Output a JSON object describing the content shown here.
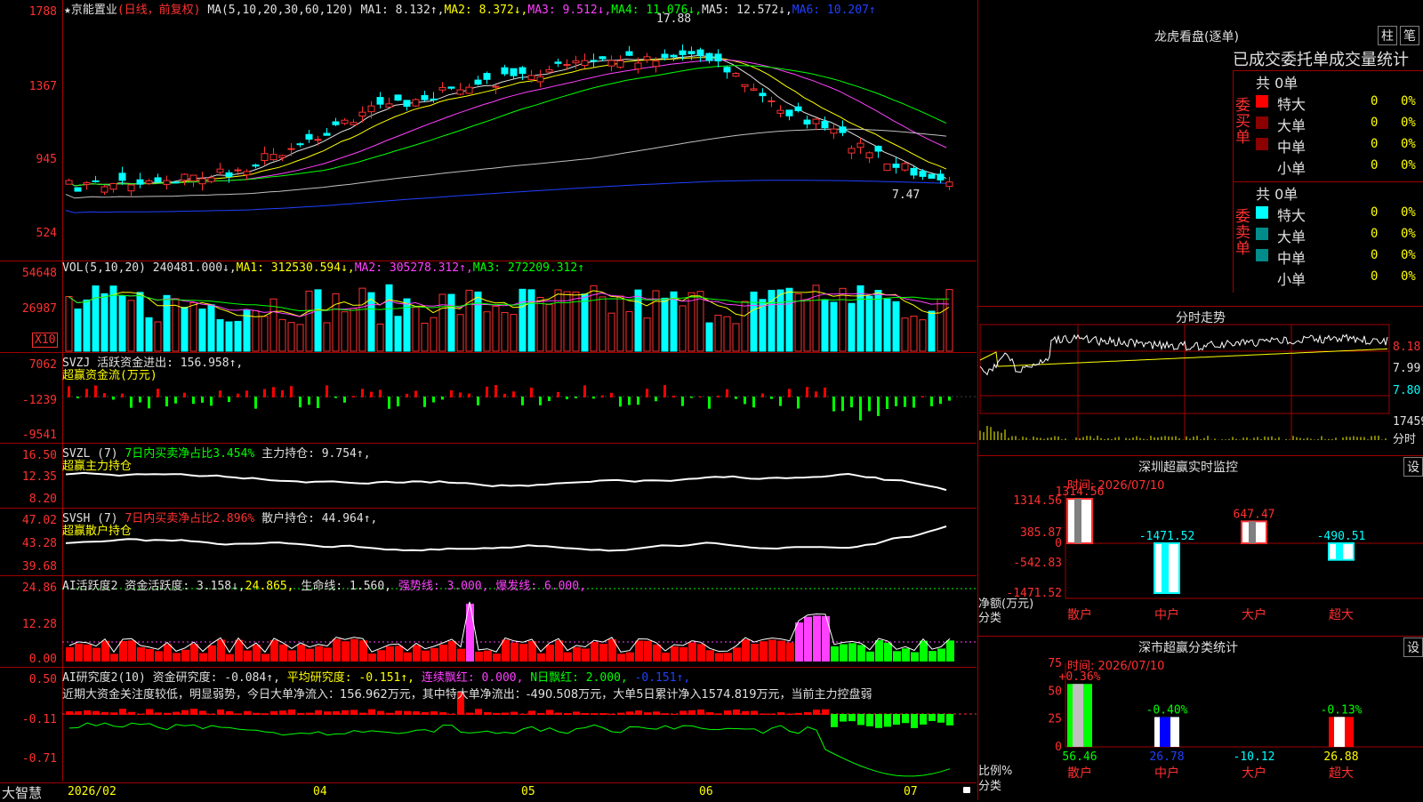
{
  "stock": {
    "star": "★",
    "name": "京能置业",
    "mode": "(日线，前复权)",
    "ma_def": "MA(5,10,20,30,60,120)",
    "ma1": "MA1: 8.132↑,",
    "ma2": "MA2: 8.372↓,",
    "ma3": "MA3: 9.512↓,",
    "ma4": "MA4: 11.076↓,",
    "ma5": "MA5: 12.572↓,",
    "ma6": "MA6: 10.207↑",
    "high_label": "17.88",
    "low_label": "7.47",
    "price_axis": [
      "1788",
      "1367",
      "945",
      "524"
    ]
  },
  "vol": {
    "def": "VOL(5,10,20)",
    "value": "240481.000↓,",
    "ma1": "MA1: 312530.594↓,",
    "ma2": "MA2: 305278.312↑,",
    "ma3": "MA3: 272209.312↑",
    "axis": [
      "54648",
      "26987",
      "X10"
    ]
  },
  "svzj": {
    "def": "SVZJ  活跃资金进出: 156.958↑,",
    "subtitle": "超赢资金流(万元)",
    "axis": [
      "7062",
      "-1239",
      "-9541"
    ]
  },
  "svzl": {
    "def": "SVZL (7)",
    "ratio": "7日内买卖净占比3.454%",
    "hold": "主力持仓: 9.754↑,",
    "subtitle": "超赢主力持仓",
    "axis": [
      "16.50",
      "12.35",
      "8.20"
    ]
  },
  "svsh": {
    "def": "SVSH (7)",
    "ratio": "7日内买卖净占比2.896%",
    "hold": "散户持仓: 44.964↑,",
    "subtitle": "超赢散户持仓",
    "axis": [
      "47.02",
      "43.28",
      "39.68"
    ]
  },
  "ai_active": {
    "def": "AI活跃度2",
    "v1": "资金活跃度: 3.158↓,",
    "v2": "24.865,",
    "v3": "生命线: 1.560,",
    "v4": "强势线: 3.000,",
    "v5": "爆发线: 6.000,",
    "axis": [
      "24.86",
      "12.28",
      "0.00"
    ]
  },
  "ai_research": {
    "def": "AI研究度2(10)",
    "v1": "资金研究度: -0.084↑,",
    "v2": "平均研究度: -0.151↑,",
    "v3": "连续飘红: 0.000,",
    "v4": "N日飘红: 2.000,",
    "v5": "-0.151↑,",
    "comment": "近期大资金关注度较低，明显弱势，今日大单净流入：156.962万元，其中特大单净流出：-490.508万元，大单5日累计净入1574.819万元，当前主力控盘弱",
    "axis": [
      "0.50",
      "-0.11",
      "-0.71"
    ]
  },
  "bottom": {
    "app": "大智慧",
    "months": [
      "2026/02",
      "04",
      "05",
      "06",
      "07"
    ]
  },
  "dragon": {
    "title": "龙虎看盘(逐单)",
    "btn1": "柱",
    "btn2": "笔",
    "subtitle": "已成交委托单成交量统计",
    "buy_label": "委买单",
    "sell_label": "委卖单",
    "buy_total": "共 0单",
    "sell_total": "共 0单",
    "rows": [
      "特大",
      "大单",
      "中单",
      "小单"
    ],
    "zero": "0",
    "pct": "0%",
    "colors_buy": [
      "#ff0000",
      "#8b0000",
      "#8b0000",
      "#000000"
    ],
    "colors_sell": [
      "#00ffff",
      "#008b8b",
      "#008b8b",
      "#000000"
    ]
  },
  "intraday": {
    "title": "分时走势",
    "prices": [
      "8.18",
      "7.99",
      "7.80"
    ],
    "vol": "17459",
    "time_label": "分时"
  },
  "sz_monitor": {
    "title": "深圳超赢实时监控",
    "btn": "设",
    "time": "时间: 2026/07/10",
    "axis": [
      "1314.56",
      "385.87",
      "0",
      "-542.83",
      "-1471.52"
    ],
    "left_label1": "净额(万元)",
    "left_label2": "分类",
    "bars": [
      {
        "label": "散户",
        "value": "1314.56"
      },
      {
        "label": "中户",
        "value": "-1471.52"
      },
      {
        "label": "大户",
        "value": "647.47"
      },
      {
        "label": "超大",
        "value": "-490.51"
      }
    ]
  },
  "sz_class": {
    "title": "深市超赢分类统计",
    "btn": "设",
    "time": "时间: 2026/07/10",
    "axis": [
      "75",
      "50",
      "25",
      "0"
    ],
    "left_label1": "比例%",
    "left_label2": "分类",
    "bars": [
      {
        "label": "散户",
        "top": "+0.36%",
        "bottom": "56.46"
      },
      {
        "label": "中户",
        "top": "-0.40%",
        "bottom": "26.78"
      },
      {
        "label": "大户",
        "top": "",
        "bottom": "-10.12"
      },
      {
        "label": "超大",
        "top": "-0.13%",
        "bottom": "26.88"
      }
    ]
  }
}
